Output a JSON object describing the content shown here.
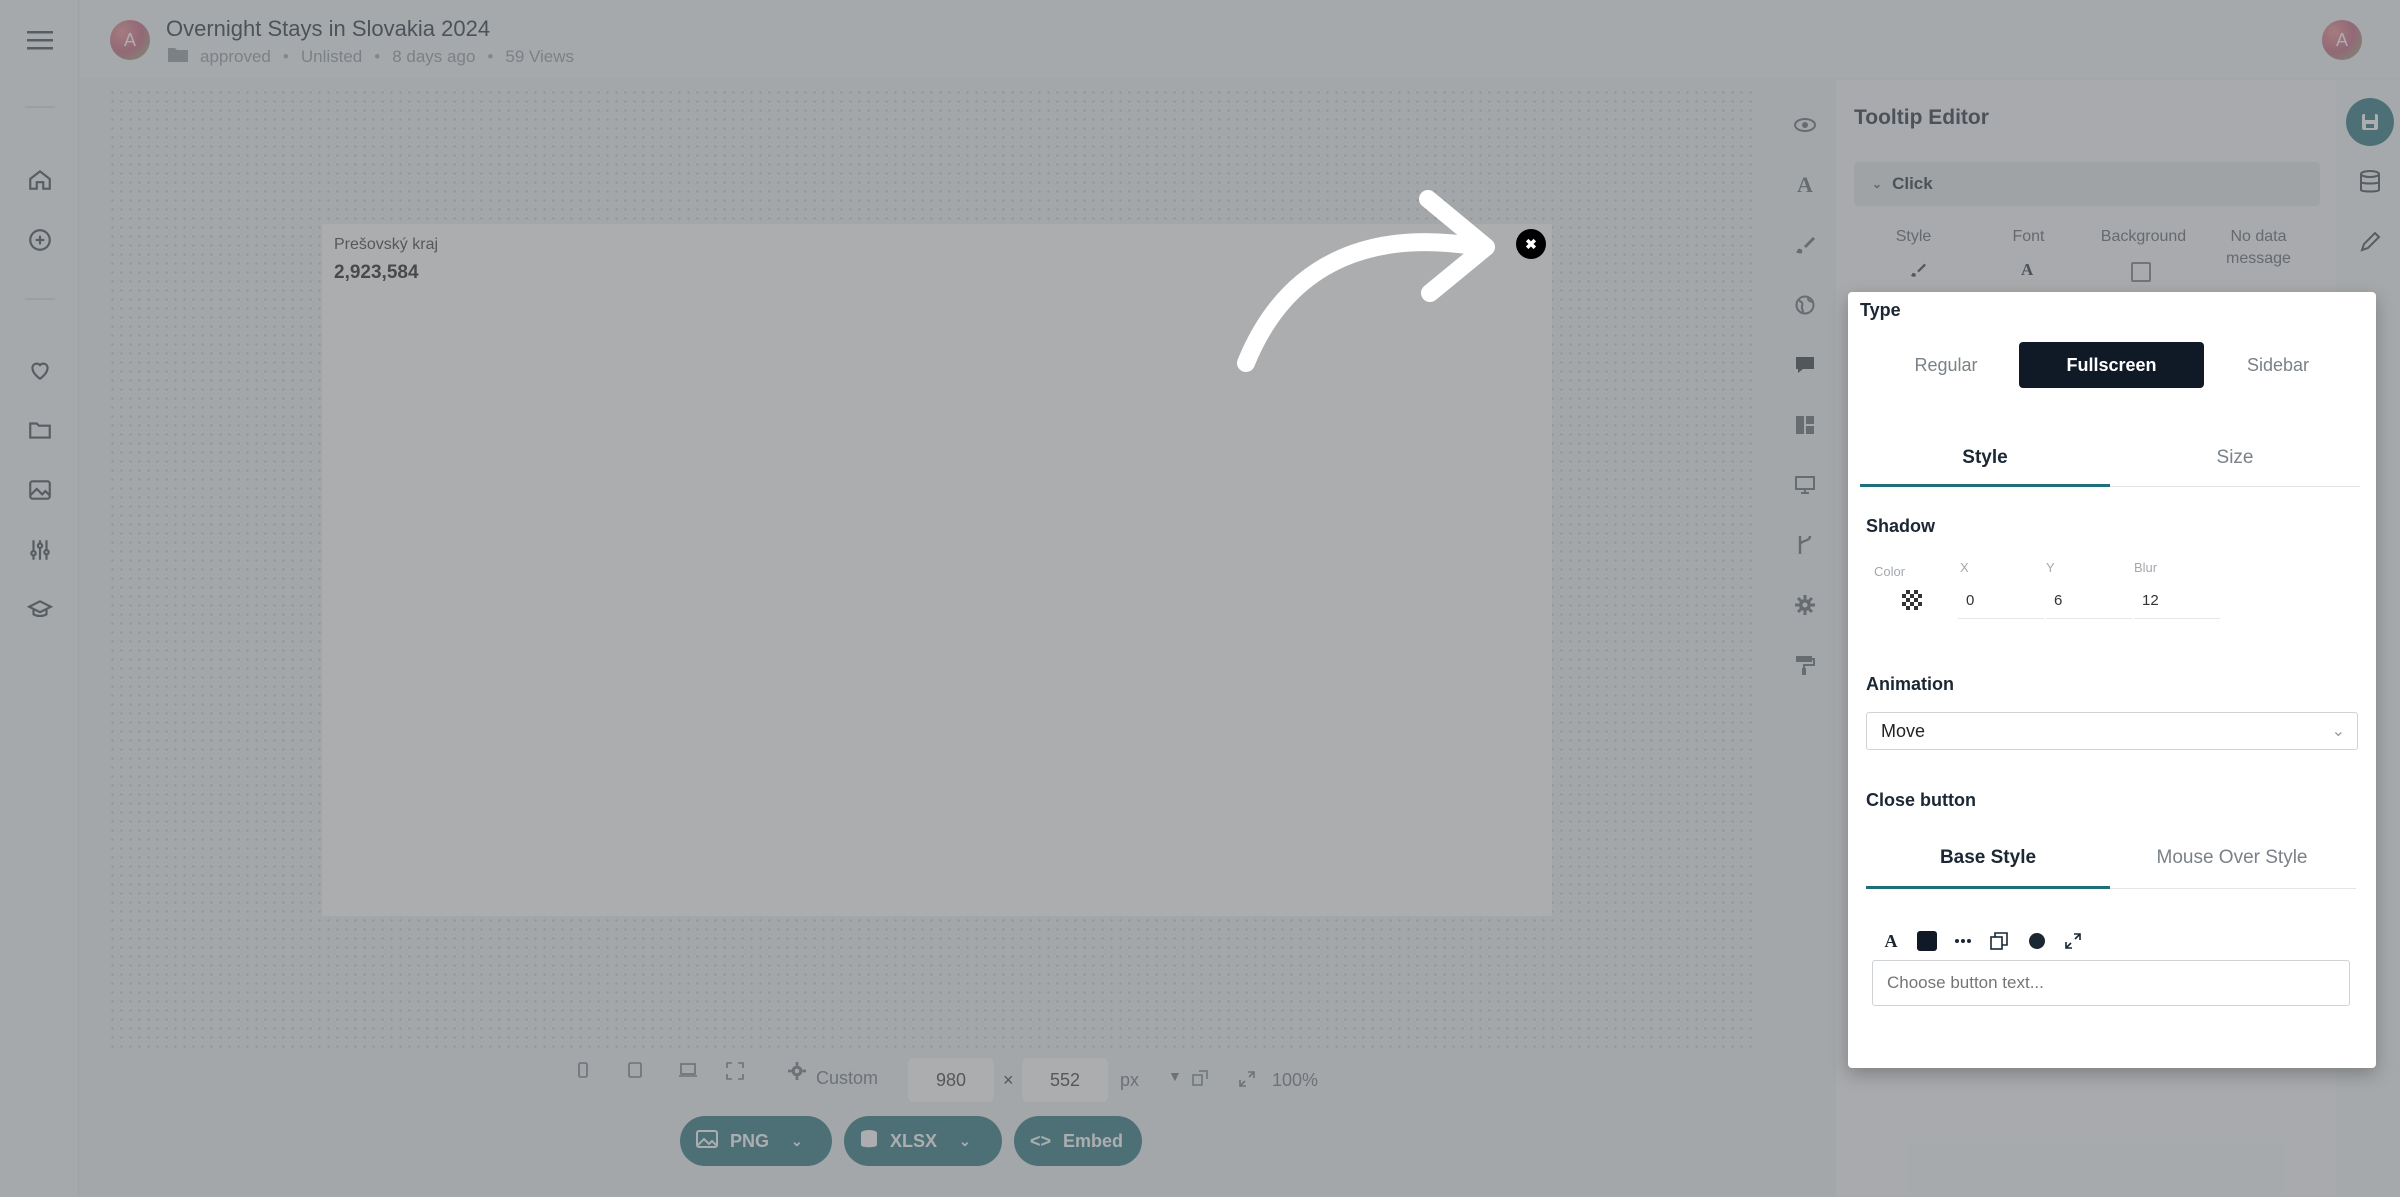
{
  "header": {
    "avatar_letter": "A",
    "title": "Overnight Stays in Slovakia 2024",
    "folder": "approved",
    "visibility": "Unlisted",
    "updated": "8 days ago",
    "views": "59 Views",
    "user_avatar_letter": "A"
  },
  "tooltip_preview": {
    "region": "Prešovský kraj",
    "value": "2,923,584",
    "close_glyph": "✖"
  },
  "panel": {
    "title": "Tooltip Editor",
    "section": "Click",
    "subtabs": [
      "Style",
      "Font",
      "Background",
      "No data message"
    ]
  },
  "popup": {
    "type_label": "Type",
    "type_options": [
      "Regular",
      "Fullscreen",
      "Sidebar"
    ],
    "type_selected": "Fullscreen",
    "tabs": [
      "Style",
      "Size"
    ],
    "shadow_label": "Shadow",
    "shadow": {
      "color_caption": "Color",
      "x_caption": "X",
      "x_value": "0",
      "y_caption": "Y",
      "y_value": "6",
      "blur_caption": "Blur",
      "blur_value": "12"
    },
    "animation_label": "Animation",
    "animation_value": "Move",
    "close_button_label": "Close button",
    "close_tabs": [
      "Base Style",
      "Mouse Over Style"
    ],
    "button_text_placeholder": "Choose button text..."
  },
  "bottom": {
    "preset": "Custom",
    "width": "980",
    "times": "×",
    "height": "552",
    "unit": "px",
    "zoom": "100%",
    "export_png": "PNG",
    "export_xlsx": "XLSX",
    "embed": "Embed"
  },
  "colors": {
    "accent": "#1f6f7a",
    "dark": "#0f1a26"
  }
}
